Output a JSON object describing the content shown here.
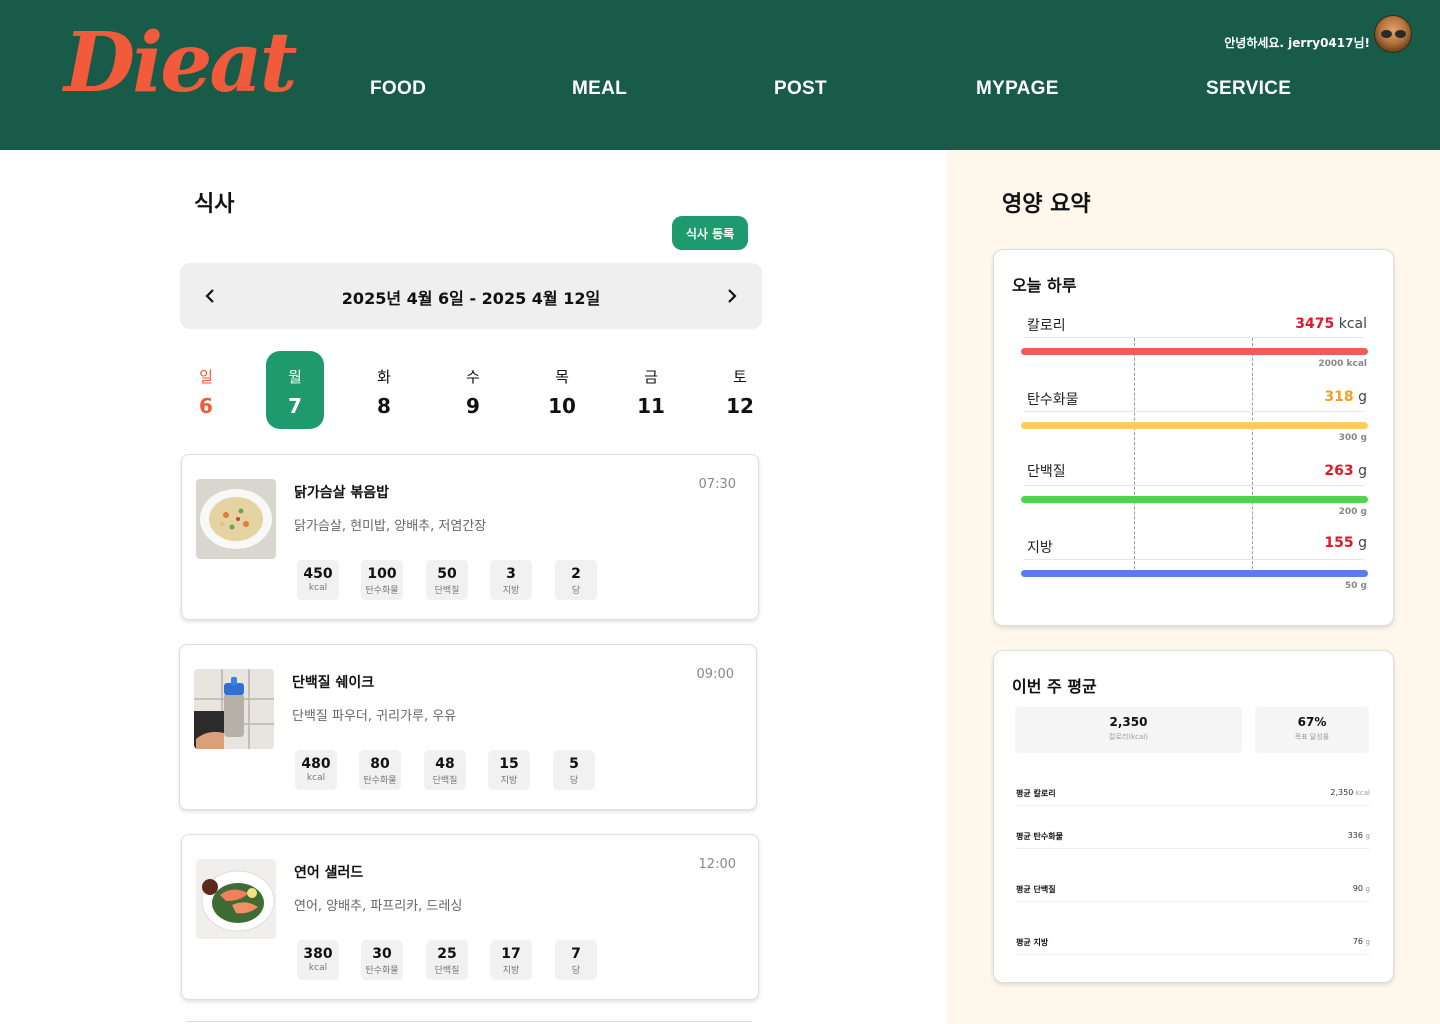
{
  "header": {
    "logo": "Dieat",
    "nav": [
      "FOOD",
      "MEAL",
      "POST",
      "MYPAGE",
      "SERVICE"
    ],
    "greeting": "안녕하세요. jerry0417님!"
  },
  "meals_section": {
    "title": "식사",
    "register_label": "식사 등록",
    "week_range": "2025년 4월 6일  -  2025 4월 12일",
    "days": [
      {
        "name": "일",
        "num": "6"
      },
      {
        "name": "월",
        "num": "7"
      },
      {
        "name": "화",
        "num": "8"
      },
      {
        "name": "수",
        "num": "9"
      },
      {
        "name": "목",
        "num": "10"
      },
      {
        "name": "금",
        "num": "11"
      },
      {
        "name": "토",
        "num": "12"
      }
    ],
    "selected_day": "7",
    "meals": [
      {
        "name": "닭가슴살 볶음밥",
        "time": "07:30",
        "ingredients": "닭가슴살, 현미밥, 양배추, 저염간장",
        "nutrients": [
          {
            "value": "450",
            "label": "kcal"
          },
          {
            "value": "100",
            "label": "탄수화물"
          },
          {
            "value": "50",
            "label": "단백질"
          },
          {
            "value": "3",
            "label": "지방"
          },
          {
            "value": "2",
            "label": "당"
          }
        ]
      },
      {
        "name": "단백질 쉐이크",
        "time": "09:00",
        "ingredients": "단백질 파우더, 귀리가루, 우유",
        "nutrients": [
          {
            "value": "480",
            "label": "kcal"
          },
          {
            "value": "80",
            "label": "탄수화물"
          },
          {
            "value": "48",
            "label": "단백질"
          },
          {
            "value": "15",
            "label": "지방"
          },
          {
            "value": "5",
            "label": "당"
          }
        ]
      },
      {
        "name": "연어 샐러드",
        "time": "12:00",
        "ingredients": "연어, 양배추, 파프리카, 드레싱",
        "nutrients": [
          {
            "value": "380",
            "label": "kcal"
          },
          {
            "value": "30",
            "label": "탄수화물"
          },
          {
            "value": "25",
            "label": "단백질"
          },
          {
            "value": "17",
            "label": "지방"
          },
          {
            "value": "7",
            "label": "당"
          }
        ]
      }
    ]
  },
  "summary": {
    "title": "영양 요약",
    "today": {
      "title": "오늘 하루",
      "rows": [
        {
          "label": "칼로리",
          "value": "3475",
          "unit": "kcal",
          "goal": "2000 kcal",
          "value_color": "#e0192a",
          "bar_color": "#f25a5a"
        },
        {
          "label": "탄수화물",
          "value": "318",
          "unit": "g",
          "goal": "300 g",
          "value_color": "#f0a020",
          "bar_color": "#fccc5c"
        },
        {
          "label": "단백질",
          "value": "263",
          "unit": "g",
          "goal": "200 g",
          "value_color": "#e0192a",
          "bar_color": "#4cd64c"
        },
        {
          "label": "지방",
          "value": "155",
          "unit": "g",
          "goal": "50 g",
          "value_color": "#e0192a",
          "bar_color": "#5a7cf0"
        }
      ]
    },
    "week": {
      "title": "이번 주 평균",
      "stats": [
        {
          "value": "2,350",
          "label": "칼로리(kcal)"
        },
        {
          "value": "67%",
          "label": "목표 달성률"
        }
      ],
      "rows": [
        {
          "label": "평균 칼로리",
          "value": "2,350",
          "unit": "kcal"
        },
        {
          "label": "평균 탄수화물",
          "value": "336",
          "unit": "g"
        },
        {
          "label": "평균 단백질",
          "value": "90",
          "unit": "g"
        },
        {
          "label": "평균 지방",
          "value": "76",
          "unit": "g"
        }
      ]
    }
  },
  "colors": {
    "header": "#175b48",
    "logo": "#f15a3a",
    "accent": "#1e9a6e",
    "panel_bg": "#fdf7ec"
  }
}
